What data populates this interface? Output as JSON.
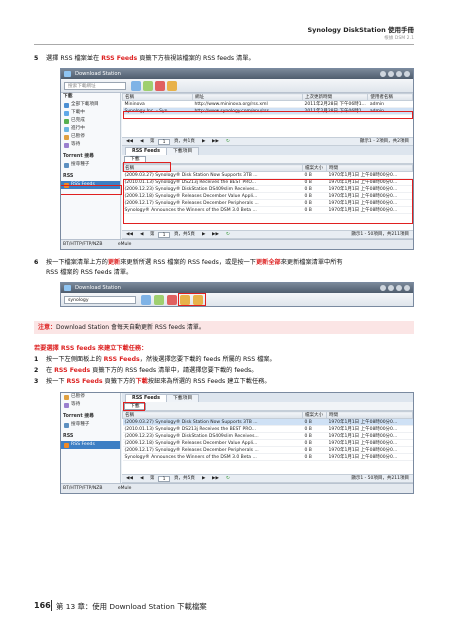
{
  "header": {
    "title": "Synology DiskStation 使用手冊",
    "subtitle": "根據 DSM 2.1"
  },
  "step5": {
    "num": "5",
    "pre": "選擇 RSS 檔案並在 ",
    "hl": "RSS Feeds",
    "post": " 頁籤下方檢視該檔案的 RSS feeds 清單。"
  },
  "win1": {
    "title": "Download Station",
    "search_placeholder": "搜索下載網址",
    "sidebar": {
      "head1": "下載",
      "items": [
        "全部下載項目",
        "下載中",
        "已完成",
        "進行中",
        "已暫停",
        "等待"
      ],
      "head2": "Torrent 搜尋",
      "item_search": "搜尋種子",
      "head3": "RSS",
      "item_rss": "RSS Feeds",
      "footer": "BT/HTTP/FTP/NZB"
    },
    "top_table": {
      "headers": [
        "名稱",
        "網址",
        "上次更新時間",
        "使用者名稱"
      ],
      "rows": [
        [
          "Mininova",
          "http://www.mininova.org/rss.xml",
          "2011年2月28日 下午06時1...",
          "admin"
        ],
        [
          "Synology Inc. - Syn...",
          "http://www.synology.com/enu/rss...",
          "2011年2月28日 下午06時1...",
          "admin"
        ]
      ]
    },
    "pager1": {
      "page_label": "第",
      "page": "1",
      "of": "頁，共1頁",
      "status": "顯示1 - 2項目，共2項目"
    },
    "tabs": [
      "RSS Feeds",
      "下載項目"
    ],
    "download_btn": "下載",
    "feed_table": {
      "headers": [
        "名稱",
        "檔案大小",
        "時間"
      ],
      "rows": [
        [
          "(2009.03.27) Synology® Disk Station Now Supports 3TB ...",
          "0 B",
          "1970年1月1日 上午08時00分0..."
        ],
        [
          "(2010.01.13) Synology® DS213j Receives the BEST PRO...",
          "0 B",
          "1970年1月1日 上午08時00分0..."
        ],
        [
          "(2009.12.23) Synology® DiskStation DS409slim Receives...",
          "0 B",
          "1970年1月1日 上午08時00分0..."
        ],
        [
          "(2009.12.18) Synology® Releases December Value Appli...",
          "0 B",
          "1970年1月1日 上午08時00分0..."
        ],
        [
          "(2009.12.17) Synology® Releases December Peripherals ...",
          "0 B",
          "1970年1月1日 上午08時00分0..."
        ],
        [
          "Synology® Announces the Winners of the DSM 3.0 Beta ...",
          "0 B",
          "1970年1月1日 上午08時00分0..."
        ]
      ]
    },
    "pager2": {
      "page_label": "第",
      "page": "1",
      "of": "頁，共5頁",
      "status": "顯示1 - 50項目，共211項目"
    },
    "statusbar": "eMule"
  },
  "step6": {
    "num": "6",
    "pre": "按一下檔案清單上方的",
    "hl1": "更新",
    "mid": "來更新所選 RSS 檔案的 RSS feeds，或是按一下",
    "hl2": "更新全部",
    "post": "來更新檔案清單中所有",
    "line2": "RSS 檔案的 RSS feeds 清單。"
  },
  "win2": {
    "title": "Download Station",
    "search_value": "synology"
  },
  "note": {
    "label": "注意：",
    "text": "Download Station 會每天自動更新 RSS feeds 清單。"
  },
  "section": {
    "title": "若要選擇 RSS feeds 來建立下載任務：",
    "items": [
      {
        "num": "1",
        "pre": "按一下左側面板上的 ",
        "hl": "RSS Feeds",
        "post": "，然後選擇您要下載的 feeds 所屬的 RSS 檔案。"
      },
      {
        "num": "2",
        "pre": "在 ",
        "hl": "RSS Feeds",
        "post": " 頁籤下方的 RSS feeds 清單中，請選擇您要下載的 feeds。"
      },
      {
        "num": "3",
        "pre": "按一下 ",
        "hl": "RSS Feeds",
        "mid": " 頁籤下方的",
        "hl2": "下載",
        "post": "按鈕來為所選的 RSS Feeds 建立下載任務。"
      }
    ]
  },
  "win3": {
    "sidebar": {
      "items": [
        "已暫停",
        "等待"
      ],
      "head2": "Torrent 搜尋",
      "item_search": "搜尋種子",
      "head3": "RSS",
      "item_rss": "RSS Feeds",
      "footer": "BT/HTTP/FTP/NZB"
    },
    "pager": {
      "page_label": "第",
      "page": "1",
      "of": "頁，共5頁",
      "status": "顯示1 - 50項目，共211項目"
    },
    "statusbar": "eMule"
  },
  "footer": {
    "page_num": "166",
    "chapter": "第 13 章：使用 Download Station 下載檔案"
  },
  "colors": {
    "highlight": "#d22222",
    "selection": "#3d7fc4"
  }
}
